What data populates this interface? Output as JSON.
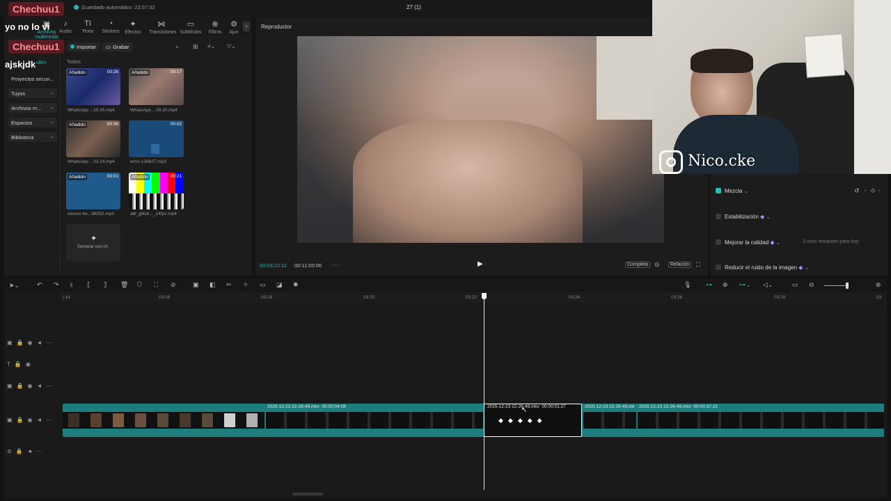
{
  "topbar": {
    "autosave": "Guardado automático: 23:57:32",
    "project_title": "27 (1)"
  },
  "chat": [
    {
      "user": "Chechuu1",
      "message": "yo no lo vi"
    },
    {
      "user": "Chechuu1",
      "message": "ajskjdk"
    }
  ],
  "toolbar": {
    "items": [
      {
        "label": "Archivos multimedia",
        "icon": "media-icon"
      },
      {
        "label": "Audio",
        "icon": "audio-icon"
      },
      {
        "label": "Texto",
        "icon": "text-icon"
      },
      {
        "label": "Stickers",
        "icon": "sticker-icon"
      },
      {
        "label": "Efectos",
        "icon": "effects-icon"
      },
      {
        "label": "Transiciones",
        "icon": "transition-icon"
      },
      {
        "label": "Subtítulos",
        "icon": "subtitles-icon"
      },
      {
        "label": "Filtros",
        "icon": "filter-icon"
      },
      {
        "label": "Ajus",
        "icon": "adjust-icon"
      }
    ]
  },
  "media": {
    "import_label": "Importar",
    "record_label": "Grabar",
    "filter_all": "Todos",
    "sidebar": {
      "multimedia": "ultim",
      "items": [
        "Proyectos secun...",
        "Tuyos",
        "Archivos m...",
        "Espacios",
        "Biblioteca"
      ]
    },
    "added_badge": "Añadido",
    "files": [
      {
        "name": "WhatsApp ...19.35.mp4",
        "duration": "00:28",
        "added": true
      },
      {
        "name": "WhatsApp ...09.30.mp4",
        "duration": "00:17",
        "added": true
      },
      {
        "name": "WhatsApp ...02.24.mp4",
        "duration": "00:38",
        "added": true
      },
      {
        "name": "error-126627.mp3",
        "duration": "00:02",
        "added": false
      },
      {
        "name": "censor-be...88052.mp3",
        "duration": "00:01",
        "added": true
      },
      {
        "name": "alb_glitch..._24fps.mp4",
        "duration": "00:21",
        "added": true
      }
    ],
    "generate_label": "Generar con IA"
  },
  "player": {
    "title": "Reproductor",
    "current_time": "00:03:22:11",
    "total_time": "00:11:00:06",
    "full_label": "Completa",
    "ratio_label": "Relación"
  },
  "webcam": {
    "handle": "Nico.cke"
  },
  "properties": {
    "blend": {
      "label": "Mezcla",
      "checked": true
    },
    "stabilize": {
      "label": "Estabilización",
      "checked": false
    },
    "enhance": {
      "label": "Mejorar la calidad",
      "checked": false,
      "note": "3 usos restantes para hoy"
    },
    "denoise": {
      "label": "Reducir el ruido de la imagen",
      "checked": false
    }
  },
  "timeline": {
    "ruler": [
      "|:14",
      "03:16",
      "03:18",
      "03:20",
      "03:22",
      "03:24",
      "03:26",
      "03:28",
      "03"
    ],
    "clips": [
      {
        "name": "2025-12-23 22-26-49.mkv",
        "duration": "00:00:04:08"
      },
      {
        "name": "2025-12-23 22-26-49.mkv",
        "duration": "00:00:01:27"
      },
      {
        "name": "2025-12-23 22-26-49.mkv",
        "duration": ""
      },
      {
        "name": "2025-12-23 22-26-49.mkv",
        "duration": "00:00:37:15"
      }
    ]
  },
  "colors": {
    "accent": "#22b5b5",
    "chat_name": "#ff8a96",
    "bg": "#131313",
    "panel": "#1c1c1c"
  }
}
